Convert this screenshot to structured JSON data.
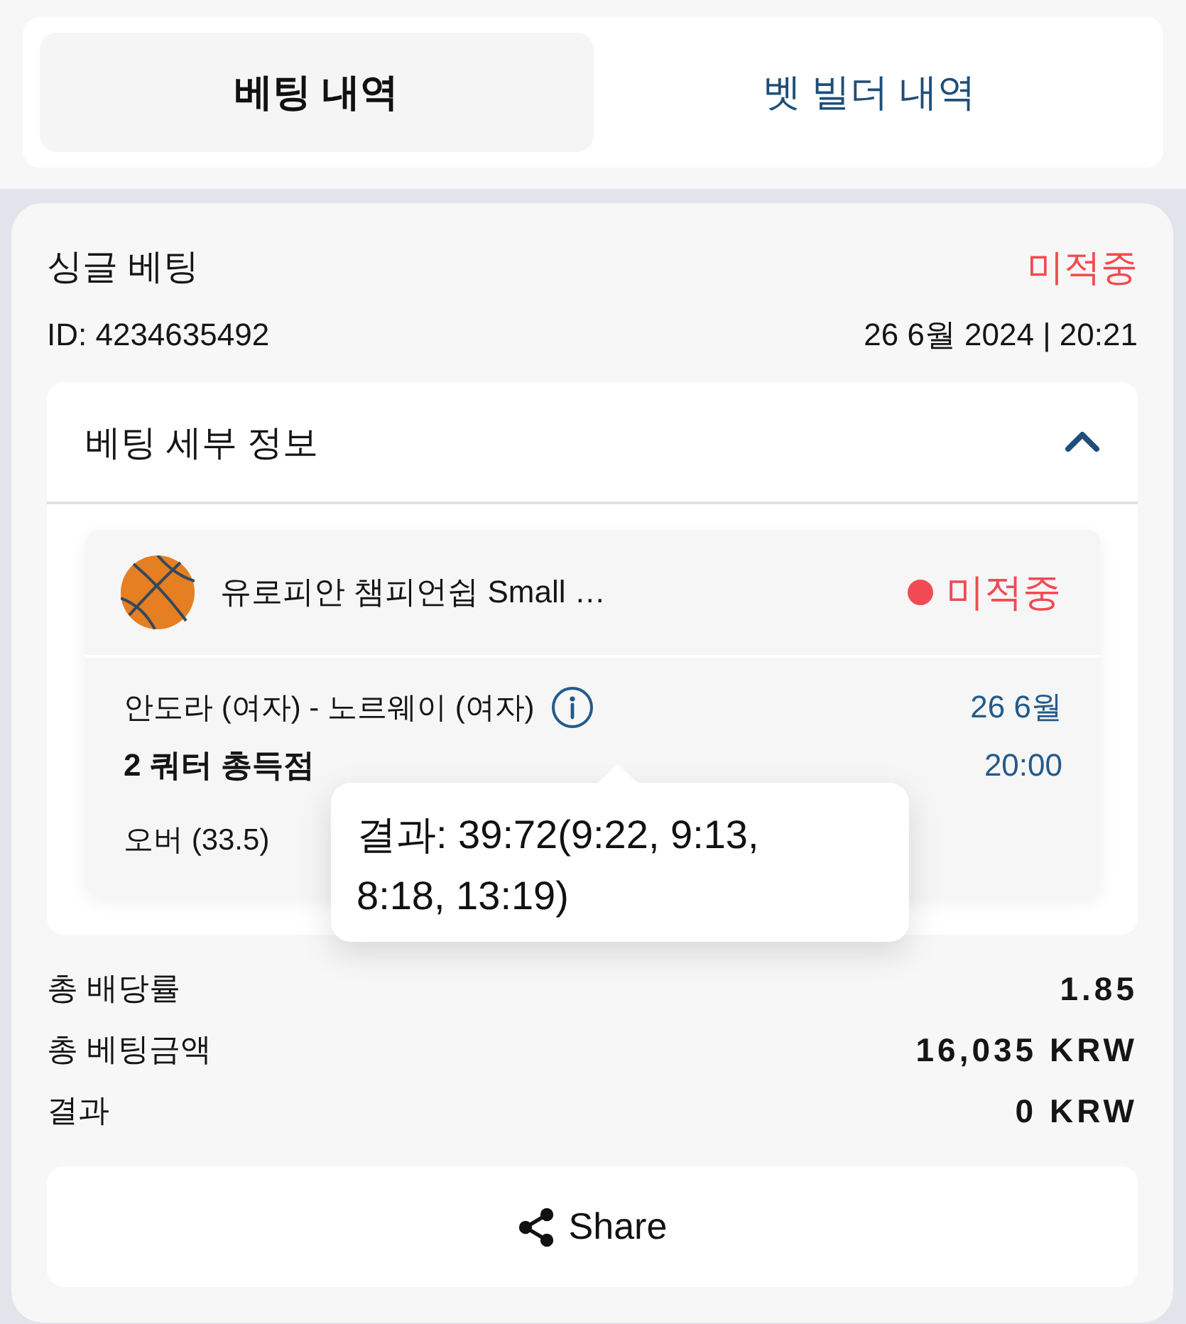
{
  "tabs": [
    {
      "label": "베팅 내역",
      "selected": true
    },
    {
      "label": "벳 빌더 내역",
      "selected": false
    }
  ],
  "bet": {
    "type": "싱글 베팅",
    "status": "미적중",
    "id": "ID: 4234635492",
    "datetime": "26 6월 2024 | 20:21",
    "details": {
      "title": "베팅 세부 정보",
      "expanded": true,
      "selections": [
        {
          "league": "유로피안 챔피언쉽 Small …",
          "status": "미적중",
          "match": "안도라 (여자) - 노르웨이 (여자)",
          "date": "26 6월",
          "market": "2 쿼터 총득점",
          "time": "20:00",
          "pick": "오버 (33.5)",
          "tooltip": "결과: 39:72(9:22, 9:13, 8:18, 13:19)"
        }
      ]
    },
    "summary": [
      {
        "label": "총 배당률",
        "value": "1.85"
      },
      {
        "label": "총 베팅금액",
        "value": "16,035 KRW"
      },
      {
        "label": "결과",
        "value": "0 KRW"
      }
    ]
  },
  "share_button": {
    "label": "Share"
  }
}
